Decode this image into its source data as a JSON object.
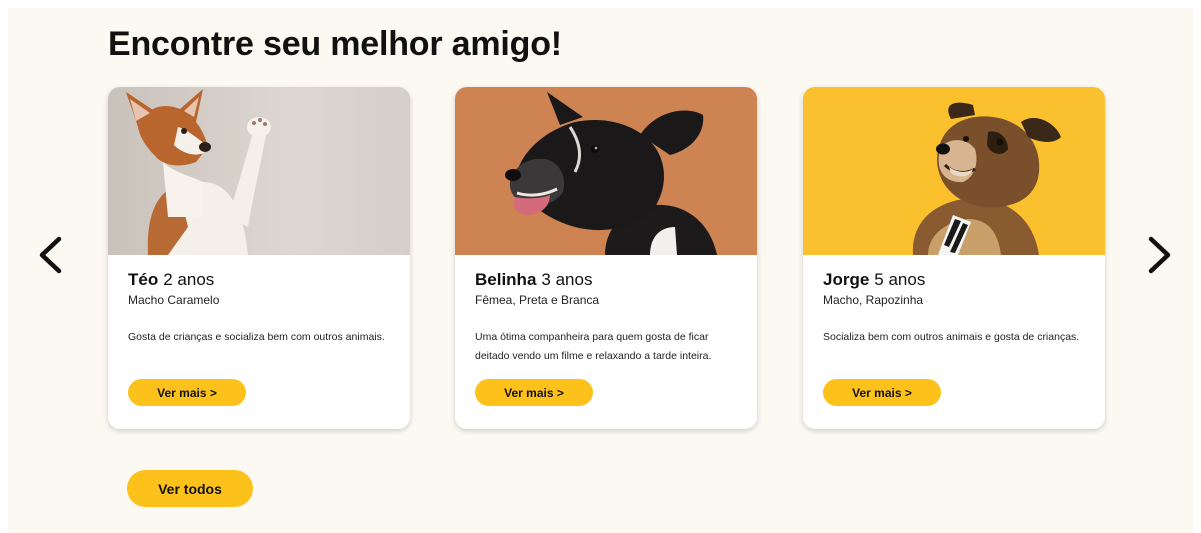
{
  "section": {
    "title": "Encontre seu melhor amigo!"
  },
  "carousel": {
    "prev_icon": "chevron-left-icon",
    "next_icon": "chevron-right-icon"
  },
  "pets": [
    {
      "name": "Téo",
      "age": "2 anos",
      "info": "Macho Caramelo",
      "description": "Gosta de crianças e socializa bem com outros animais.",
      "button_label": "Ver mais >",
      "photo_background": "#d8d2cc"
    },
    {
      "name": "Belinha",
      "age": "3 anos",
      "info": "Fêmea, Preta e Branca",
      "description": "Uma ótima companheira para quem gosta de ficar deitado vendo um filme e relaxando a tarde inteira.",
      "button_label": "Ver mais >",
      "photo_background": "#cd8352"
    },
    {
      "name": "Jorge",
      "age": "5 anos",
      "info": "Macho, Rapozinha",
      "description": "Socializa bem com outros animais e gosta de crianças.",
      "button_label": "Ver mais >",
      "photo_background": "#fbc02d"
    }
  ],
  "footer": {
    "view_all_label": "Ver todos"
  },
  "colors": {
    "accent": "#fcc21b",
    "page_background": "#fcf9f2",
    "text": "#111111"
  }
}
